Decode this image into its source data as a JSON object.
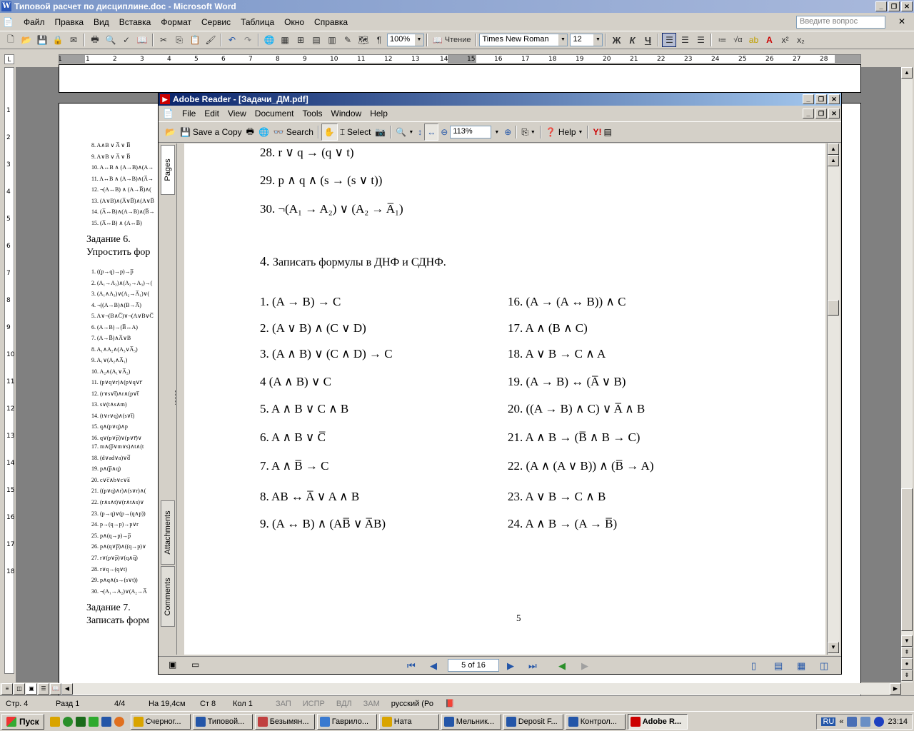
{
  "word": {
    "title": "Типовой расчет по дисциплине.doc - Microsoft Word",
    "menu": [
      "Файл",
      "Правка",
      "Вид",
      "Вставка",
      "Формат",
      "Сервис",
      "Таблица",
      "Окно",
      "Справка"
    ],
    "help_placeholder": "Введите вопрос",
    "zoom": "100%",
    "reading_label": "Чтение",
    "font_name": "Times New Roman",
    "font_size": "12",
    "bold": "Ж",
    "italic": "К",
    "underline": "Ч",
    "ruler_ticks": [
      "1",
      "1",
      "2",
      "3",
      "4",
      "5",
      "6",
      "7",
      "8",
      "9",
      "10",
      "11",
      "12",
      "13",
      "14",
      "15",
      "16",
      "17",
      "18",
      "19",
      "20",
      "21",
      "22",
      "23",
      "24",
      "25",
      "26",
      "27",
      "28"
    ],
    "vruler_ticks": [
      "1",
      "2",
      "3",
      "4",
      "5",
      "6",
      "7",
      "8",
      "9",
      "10",
      "11",
      "12",
      "13",
      "14",
      "15",
      "16",
      "17",
      "18"
    ],
    "doc_fragments": {
      "task6_title": "Задание 6.",
      "task6_text": "Упростить фор",
      "task7_title": "Задание 7.",
      "task7_text": "Записать форм",
      "list_top": [
        "8. A∧B ∨ A̅ ∨ B̅",
        "9. A∨B ∨ A̅ ∨ B̅",
        "10. A↔B ∧ (A→B)∧(A→",
        "11. A↔B ∧ (A→B)∧(A̅→",
        "12. ¬(A↔B) ∧ (A→B̅)∧(",
        "13. (A∨B)∧(A̅∨B̅)∧(A∨B̅",
        "14. (A̅↔B)∧(A→B)∧(B̅→",
        "15. (A̅↔B) ∧ (A↔B̅)"
      ],
      "list_mid": [
        "1. ((p→q)→p)→p̅",
        "2. (A₁→A₂)∧(A₂→A₃)→(",
        "3. (A₁∧A₃)∨(A₂→A̅₁)∨(",
        "4. ¬((A→B)∧(B→A̅)",
        "5. A∨¬(B∧C̅)∨¬(A∨B∨C̅",
        "6. (A→B)→(B̅↔A)",
        "7. (A→B̅)∧A̅∨B",
        "8. A₁∧A₂∧(A₃∨A̅₃)",
        "9. A₁∨(A₂∧A̅₁)",
        "10. A₂∧(A₁∨A̅₂)",
        "11. (p∨q∨r)∧(p∨q∨r̅",
        "12. (r∨s∨t̅)∧r∧(p∨t̅",
        "13. s∨(t∧s∧m)",
        "14. (t∨r∨q)∧(s∨t̅)",
        "15. q∧(p∨q)∧p",
        "16. q∨(p∨p̅)∨(p∨r̅)∨"
      ],
      "list_low": [
        "17. m∧(p̅∨m∨s)∧t∧(t",
        "18. (d∨ad∨a)∨d̅",
        "19. p∧(p̅∧q)",
        "20. c∨c̅∧b∨c∨a̅",
        "21. ((p∨q)∧r)∧(s∨r)∧(",
        "22. (r∧s∧t)∨(r∧t∧s)∨",
        "23. (p→q)∨(p→(q∧p))",
        "24. p→(q→p)→p∨r",
        "25. p∧(q→p)→p̅",
        "26. p∧(q∨p̅)∧((q→p)∨",
        "27. r∨(p∨p̅)∨(q∧q̅)",
        "28. r∨q→(q∨t)",
        "29. p∧q∧(s→(s∨t))",
        "30. ¬(A₁→A₂)∨(A₂→A̅"
      ]
    },
    "status": {
      "page": "Стр. 4",
      "section": "Разд 1",
      "pages": "4/4",
      "at": "На 19,4см",
      "line": "Ст 8",
      "col": "Кол 1",
      "rec": "ЗАП",
      "trk": "ИСПР",
      "ext": "ВДЛ",
      "ovr": "ЗАМ",
      "lang": "русский (Ро"
    }
  },
  "reader": {
    "title": "Adobe Reader - [Задачи_ДМ.pdf]",
    "menu": [
      "File",
      "Edit",
      "View",
      "Document",
      "Tools",
      "Window",
      "Help"
    ],
    "toolbar": {
      "save_copy": "Save a Copy",
      "search": "Search",
      "select": "Select",
      "zoom": "113%",
      "help": "Help"
    },
    "side_tabs": [
      "Pages",
      "Attachments",
      "Comments"
    ],
    "page_field": "5 of 16",
    "content": {
      "prev_items": [
        "28. r ∨ q → (q ∨ t)",
        "29. p ∧ q ∧ (s → (s ∨ t))",
        "30. ¬(A₁ → A₂) ∨ (A₂ → A̅₁)"
      ],
      "section_number": "4.",
      "section_title": "Записать формулы в ДНФ и СДНФ.",
      "left_col": [
        "1. (A → B) → C",
        "2. (A ∨ B) ∧ (C ∨ D)",
        "3. (A ∧ B) ∨ (C ∧ D) → C",
        "4 (A ∧ B) ∨ C",
        "5. A ∧ B ∨ C ∧ B",
        "6. A ∧ B ∨ C̅",
        "7. A ∧ B̅ → C",
        "8. AB ↔ A̅ ∨ A ∧ B",
        "9. (A ↔ B) ∧ (AB̅ ∨ A̅B)"
      ],
      "right_col": [
        "16. (A → (A ↔ B)) ∧ C",
        "17. A ∧ (B ∧ C)",
        "18. A ∨ B → C ∧ A",
        "19. (A → B) ↔ (A̅ ∨ B)",
        "20. ((A → B) ∧ C) ∨ A̅ ∧ B",
        "21. A ∧ B → (B̅ ∧ B → C)",
        "22. (A ∧ (A ∨ B)) ∧ (B̅ → A)",
        "23. A ∨ B → C ∧ B",
        "24. A ∧ B → (A → B̅)"
      ],
      "page_number": "5"
    }
  },
  "taskbar": {
    "start": "Пуск",
    "buttons": [
      "Счерног...",
      "Типовой...",
      "Безымян...",
      "Гаврило...",
      "Ната",
      "Мельник...",
      "Deposit F...",
      "Контрол...",
      "Adobe R..."
    ],
    "lang": "RU",
    "clock": "23:14"
  }
}
